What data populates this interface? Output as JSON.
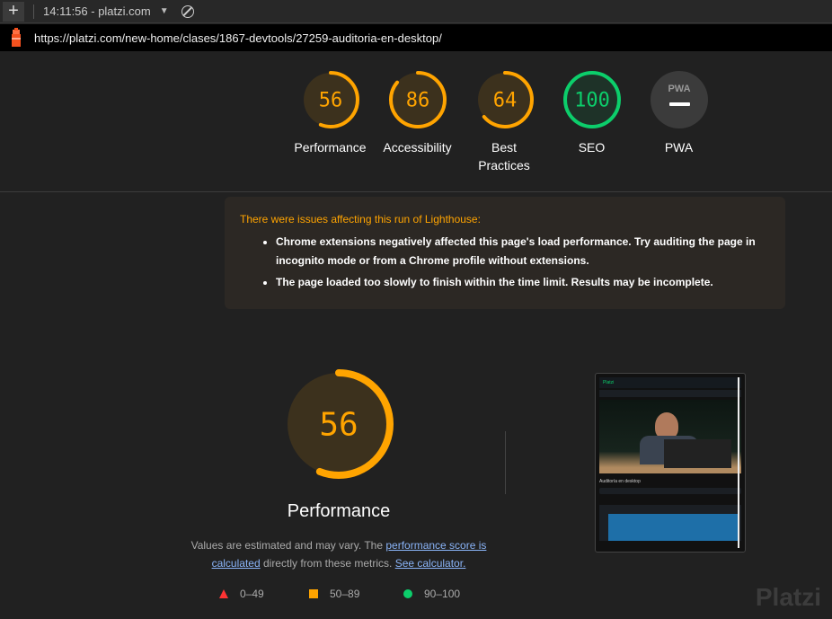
{
  "topbar": {
    "new_tab": "+",
    "report_title": "14:11:56 - platzi.com",
    "dropdown": "▼"
  },
  "url": "https://platzi.com/new-home/clases/1867-devtools/27259-auditoria-en-desktop/",
  "colors": {
    "orange": "#ffa400",
    "green": "#0cce6b",
    "red": "#ff3333",
    "gray": "#3b3b3b"
  },
  "categories": [
    {
      "score": 56,
      "label": "Performance",
      "color": "#ffa400"
    },
    {
      "score": 86,
      "label": "Accessibility",
      "color": "#ffa400"
    },
    {
      "score": 64,
      "label": "Best Practices",
      "color": "#ffa400"
    },
    {
      "score": 100,
      "label": "SEO",
      "color": "#0cce6b"
    },
    {
      "score": null,
      "label": "PWA",
      "badge": "PWA",
      "color": "#888"
    }
  ],
  "warning": {
    "title": "There were issues affecting this run of Lighthouse:",
    "items": [
      "Chrome extensions negatively affected this page's load performance. Try auditing the page in incognito mode or from a Chrome profile without extensions.",
      "The page loaded too slowly to finish within the time limit. Results may be incomplete."
    ]
  },
  "performance": {
    "score": 56,
    "title": "Performance",
    "desc_1": "Values are estimated and may vary. The ",
    "link_1": "performance score is calculated",
    "desc_2": " directly from these metrics. ",
    "link_2": "See calculator."
  },
  "legend": [
    {
      "icon": "triangle",
      "range": "0–49"
    },
    {
      "icon": "square",
      "range": "50–89"
    },
    {
      "icon": "circle",
      "range": "90–100"
    }
  ],
  "screenshot": {
    "brand": "Platzi",
    "heading": "Auditoría en desktop"
  },
  "watermark": "Platzi"
}
